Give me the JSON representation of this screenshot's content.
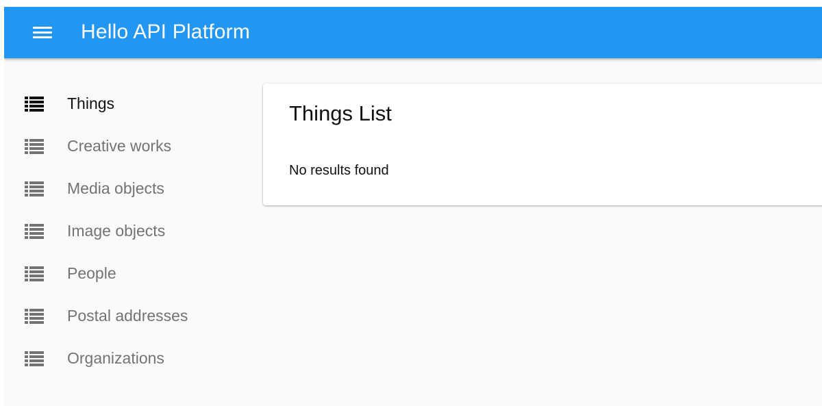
{
  "appbar": {
    "title": "Hello API Platform",
    "menu_icon": "menu-icon",
    "color": "#2196f3"
  },
  "sidebar": {
    "items": [
      {
        "label": "Things",
        "icon": "list-icon",
        "active": true
      },
      {
        "label": "Creative works",
        "icon": "list-icon",
        "active": false
      },
      {
        "label": "Media objects",
        "icon": "list-icon",
        "active": false
      },
      {
        "label": "Image objects",
        "icon": "list-icon",
        "active": false
      },
      {
        "label": "People",
        "icon": "list-icon",
        "active": false
      },
      {
        "label": "Postal addresses",
        "icon": "list-icon",
        "active": false
      },
      {
        "label": "Organizations",
        "icon": "list-icon",
        "active": false
      }
    ],
    "active_color": "#111111",
    "inactive_color": "#737373"
  },
  "main": {
    "title": "Things List",
    "empty_message": "No results found"
  }
}
